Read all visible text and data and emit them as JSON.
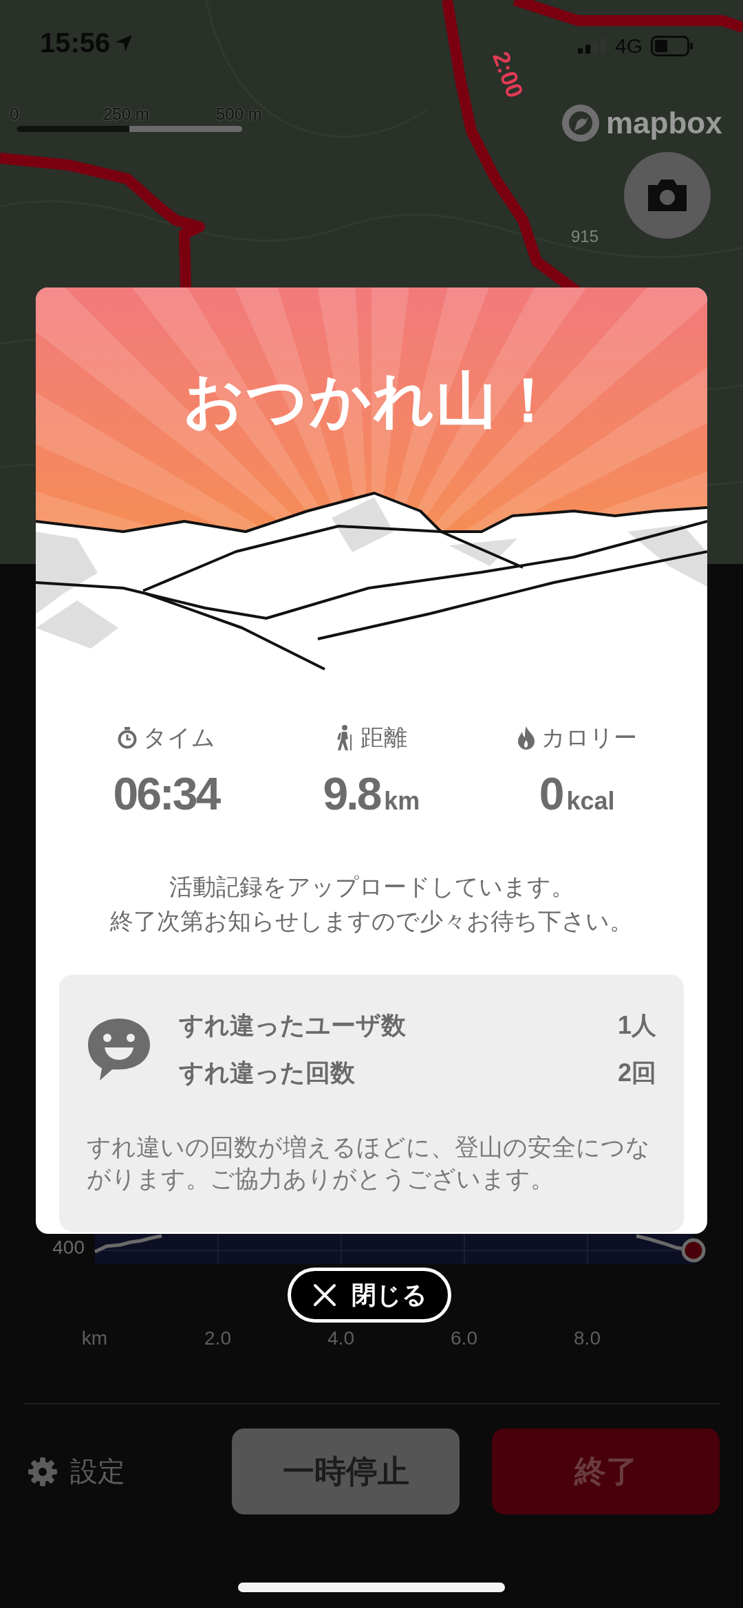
{
  "status_bar": {
    "time": "15:56",
    "network": "4G"
  },
  "map": {
    "scale_labels": [
      "0",
      "250 m",
      "500 m"
    ],
    "attribution": "mapbox",
    "route_time_label": "2:00",
    "elevation_label": "915"
  },
  "elevation_chart": {
    "y_label": "400",
    "x_labels": [
      "km",
      "2.0",
      "4.0",
      "6.0",
      "8.0"
    ]
  },
  "controls": {
    "settings": "設定",
    "pause": "一時停止",
    "finish": "終了"
  },
  "dialog": {
    "title": "おつかれ山！",
    "stats": [
      {
        "kind": "time",
        "label": "タイム",
        "value": "06:34"
      },
      {
        "kind": "distance",
        "label": "距離",
        "value": "9.8",
        "unit": "km"
      },
      {
        "kind": "calories",
        "label": "カロリー",
        "value": "0",
        "unit": "kcal"
      }
    ],
    "message": [
      "活動記録をアップロードしています。",
      "終了次第お知らせしますので少々お待ち下さい。"
    ],
    "encounters": {
      "rows": [
        {
          "label": "すれ違ったユーザ数",
          "value": "1人"
        },
        {
          "label": "すれ違った回数",
          "value": "2回"
        }
      ],
      "note": "すれ違いの回数が増えるほどに、登山の安全につながります。ご協力ありがとうございます。"
    },
    "close": "閉じる"
  }
}
